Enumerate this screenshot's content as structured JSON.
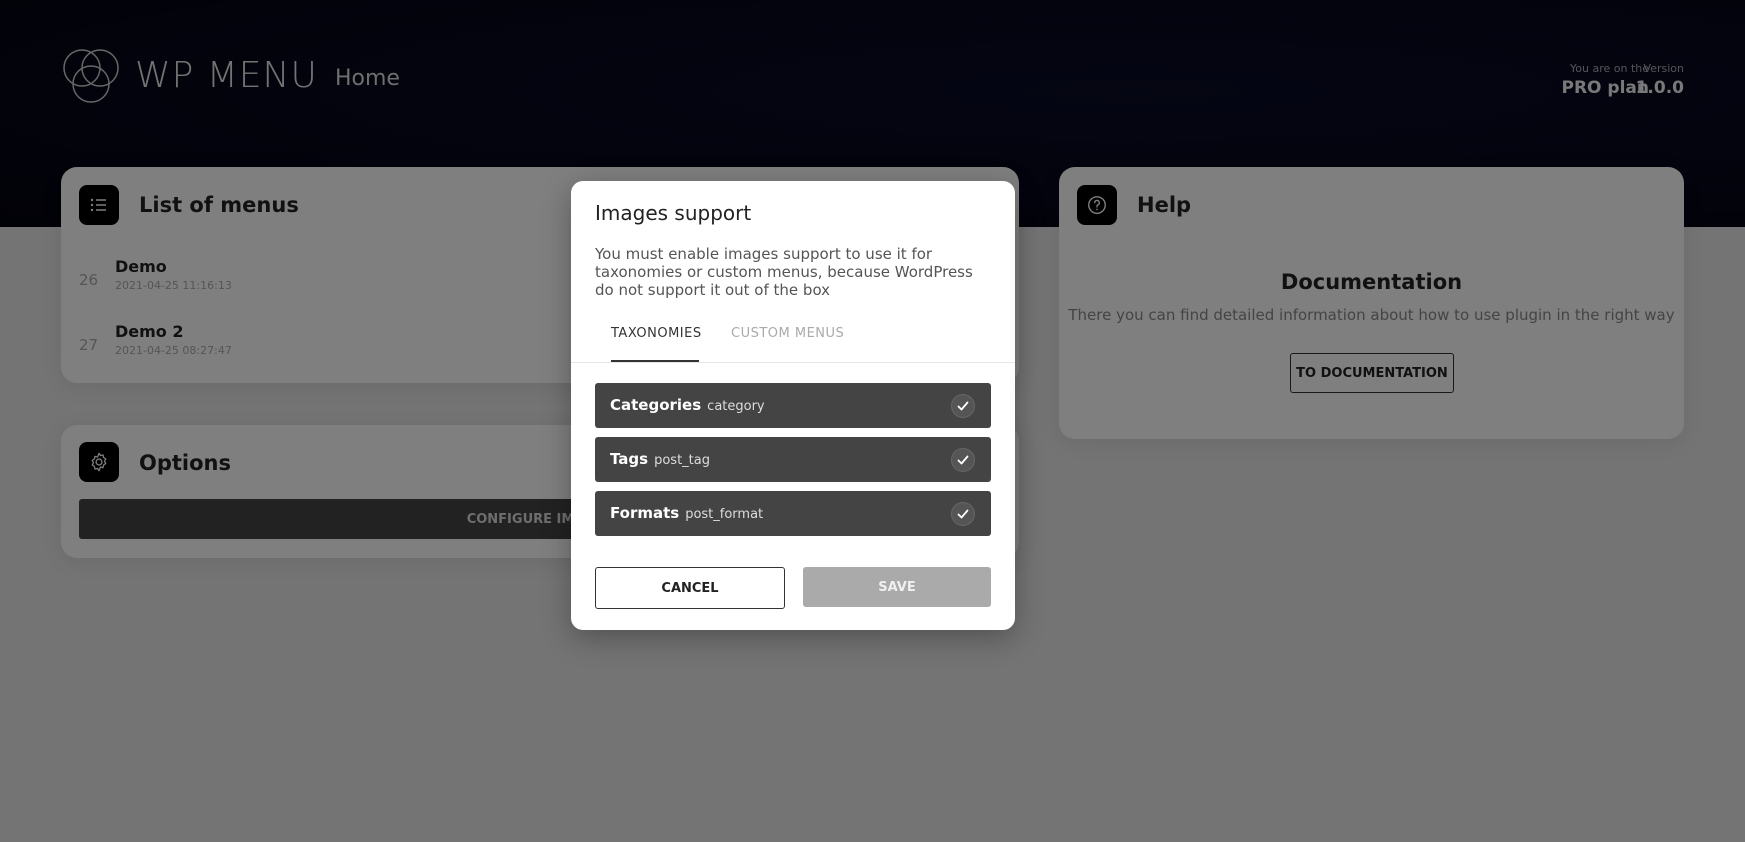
{
  "header": {
    "brand": "WP MENU",
    "page_title": "Home",
    "plan_label": "You are on the",
    "plan_value": "PRO plan",
    "version_label": "Version",
    "version_value": "1.0.0"
  },
  "menus_card": {
    "title": "List of menus",
    "icon": "list-icon",
    "items": [
      {
        "id": "26",
        "name": "Demo",
        "date": "2021-04-25 11:16:13"
      },
      {
        "id": "27",
        "name": "Demo 2",
        "date": "2021-04-25 08:27:47"
      }
    ]
  },
  "options_card": {
    "title": "Options",
    "icon": "gear-icon",
    "configure_label": "CONFIGURE IMAGES"
  },
  "help_card": {
    "title": "Help",
    "icon": "question-icon",
    "heading": "Documentation",
    "text": "There you can find detailed information about how to use plugin in the right way",
    "button_label": "TO DOCUMENTATION"
  },
  "modal": {
    "title": "Images support",
    "description": "You must enable images support to use it for taxonomies or custom menus, because WordPress do not support it out of the box",
    "tabs": [
      {
        "label": "TAXONOMIES",
        "active": true
      },
      {
        "label": "CUSTOM MENUS",
        "active": false
      }
    ],
    "taxonomies": [
      {
        "name": "Categories",
        "slug": "category",
        "checked": true
      },
      {
        "name": "Tags",
        "slug": "post_tag",
        "checked": true
      },
      {
        "name": "Formats",
        "slug": "post_format",
        "checked": true
      }
    ],
    "cancel_label": "CANCEL",
    "save_label": "SAVE"
  }
}
